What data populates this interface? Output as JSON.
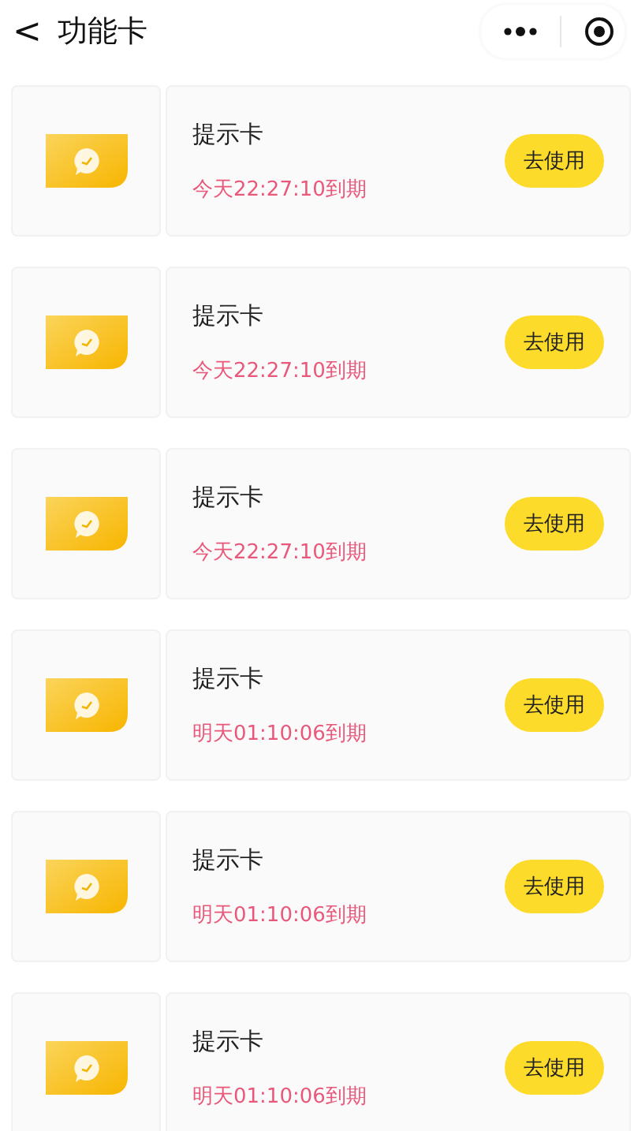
{
  "nav": {
    "back": "<",
    "title": "功能卡"
  },
  "cards": [
    {
      "name": "提示卡",
      "expiry": "今天22:27:10到期",
      "action": "去使用"
    },
    {
      "name": "提示卡",
      "expiry": "今天22:27:10到期",
      "action": "去使用"
    },
    {
      "name": "提示卡",
      "expiry": "今天22:27:10到期",
      "action": "去使用"
    },
    {
      "name": "提示卡",
      "expiry": "明天01:10:06到期",
      "action": "去使用"
    },
    {
      "name": "提示卡",
      "expiry": "明天01:10:06到期",
      "action": "去使用"
    },
    {
      "name": "提示卡",
      "expiry": "明天01:10:06到期",
      "action": "去使用"
    }
  ]
}
